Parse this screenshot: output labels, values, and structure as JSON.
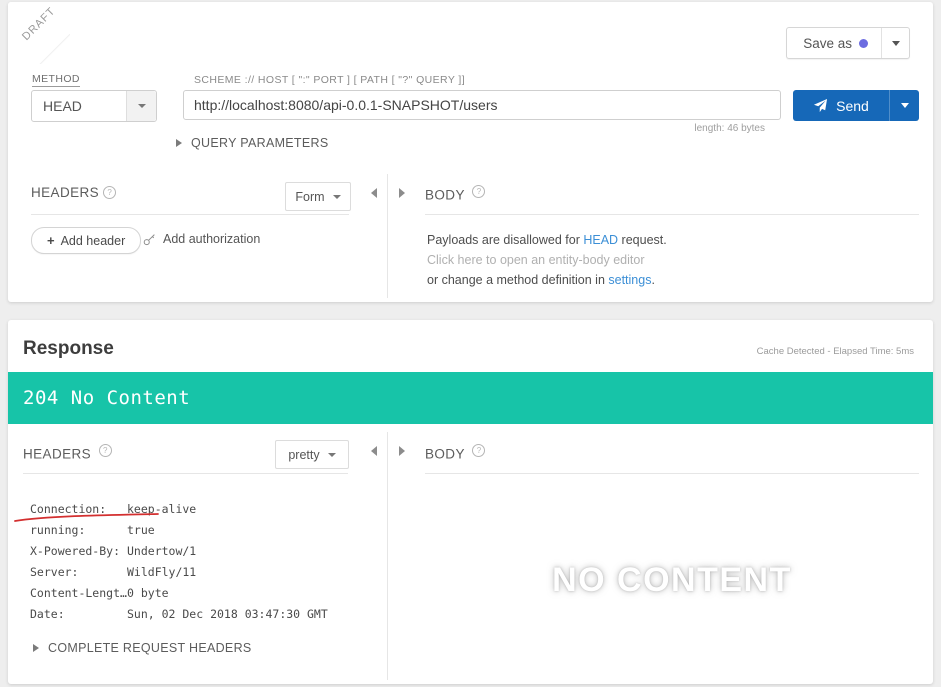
{
  "request": {
    "ribbon_label": "DRAFT",
    "save_as_label": "Save as",
    "method_label": "METHOD",
    "method_value": "HEAD",
    "url_label": "SCHEME :// HOST [ \":\" PORT ] [ PATH [ \"?\" QUERY ]]",
    "url_value": "http://localhost:8080/api-0.0.1-SNAPSHOT/users",
    "url_placeholder": "http://",
    "length_note": "length: 46 bytes",
    "send_label": "Send",
    "query_parameters_label": "QUERY PARAMETERS",
    "headers_title": "HEADERS",
    "headers_view_mode": "Form",
    "add_header_label": "Add header",
    "add_authorization_label": "Add authorization",
    "body_title": "BODY",
    "body_line1_pre": "Payloads are disallowed for ",
    "body_line1_link": "HEAD",
    "body_line1_post": " request.",
    "body_line2": "Click here to open an entity-body editor",
    "body_line3_pre": "or change a method definition in ",
    "body_line3_link": "settings",
    "body_line3_post": "."
  },
  "response": {
    "title": "Response",
    "cache_note": "Cache Detected - Elapsed Time: 5ms",
    "status": "204 No Content",
    "status_color": "#17c4a8",
    "headers_title": "HEADERS",
    "headers_view_mode": "pretty",
    "body_title": "BODY",
    "watermark": "NO CONTENT",
    "complete_request_headers_label": "COMPLETE REQUEST HEADERS",
    "headers": [
      {
        "name": "Connection:",
        "value": "keep-alive"
      },
      {
        "name": "running:",
        "value": "true"
      },
      {
        "name": "X-Powered-By:",
        "value": "Undertow/1"
      },
      {
        "name": "Server:",
        "value": "WildFly/11"
      },
      {
        "name": "Content-Lengt…",
        "value": "0 byte"
      },
      {
        "name": "Date:",
        "value": "Sun, 02 Dec 2018 03:47:30 GMT"
      }
    ]
  },
  "colors": {
    "accent_send": "#1668b8",
    "accent_status": "#17c4a8",
    "save_dot": "#6c6ce0",
    "link": "#3c8fd6",
    "annotation": "#d32f2f"
  }
}
